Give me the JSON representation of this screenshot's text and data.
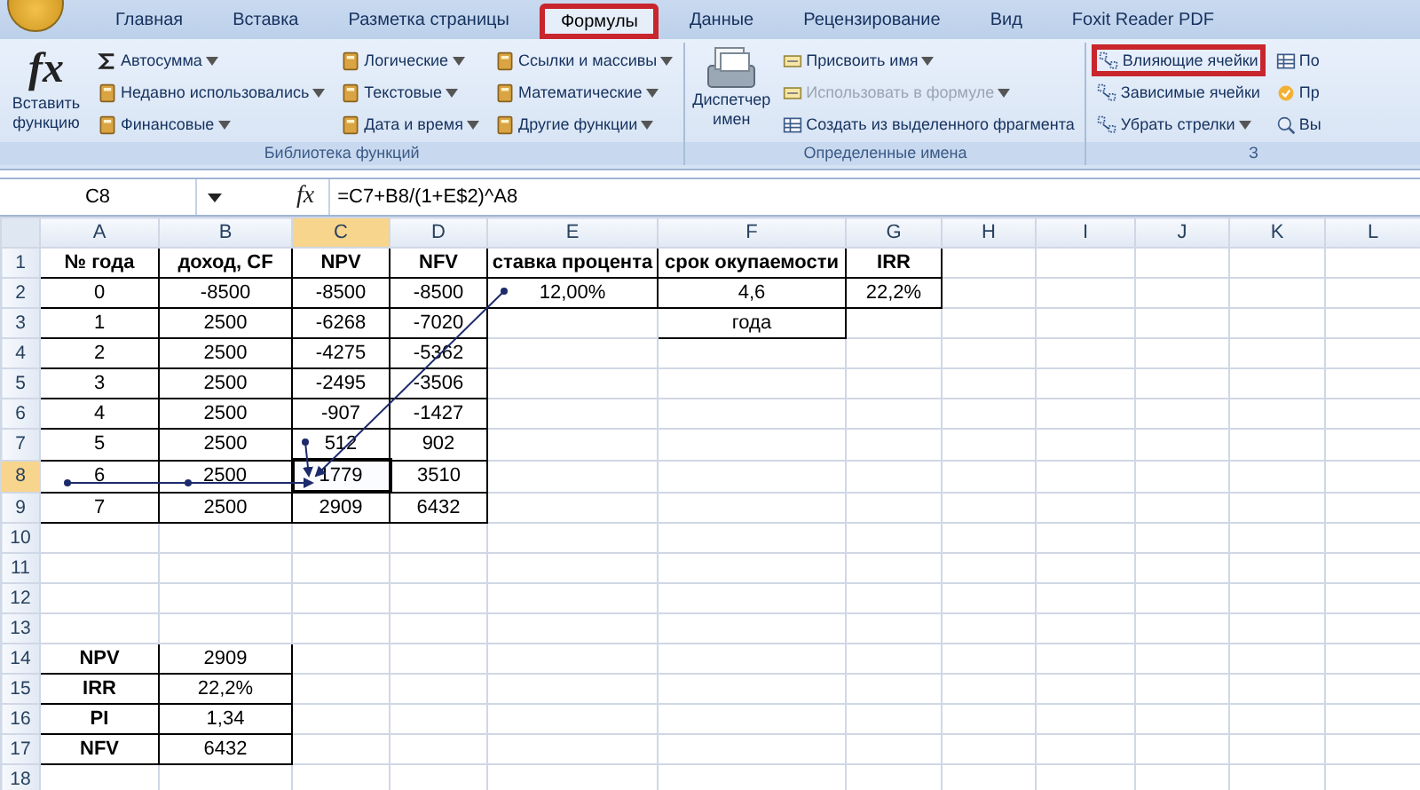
{
  "tabs": [
    {
      "label": "Главная",
      "selected": false,
      "highlighted": false
    },
    {
      "label": "Вставка",
      "selected": false,
      "highlighted": false
    },
    {
      "label": "Разметка страницы",
      "selected": false,
      "highlighted": false
    },
    {
      "label": "Формулы",
      "selected": true,
      "highlighted": true
    },
    {
      "label": "Данные",
      "selected": false,
      "highlighted": false
    },
    {
      "label": "Рецензирование",
      "selected": false,
      "highlighted": false
    },
    {
      "label": "Вид",
      "selected": false,
      "highlighted": false
    },
    {
      "label": "Foxit Reader PDF",
      "selected": false,
      "highlighted": false
    }
  ],
  "ribbon": {
    "groups": [
      {
        "label": "Библиотека функций",
        "columns": [
          [
            {
              "kind": "large",
              "icon_text": "fx",
              "label": "Вставить функцию",
              "disabled": false
            }
          ],
          [
            {
              "kind": "small",
              "label": "Автосумма",
              "dropdown": true,
              "disabled": false,
              "highlighted": false
            },
            {
              "kind": "small",
              "label": "Недавно использовались",
              "dropdown": true,
              "disabled": false,
              "highlighted": false
            },
            {
              "kind": "small",
              "label": "Финансовые",
              "dropdown": true,
              "disabled": false,
              "highlighted": false
            }
          ],
          [
            {
              "kind": "small",
              "label": "Логические",
              "dropdown": true,
              "disabled": false,
              "highlighted": false
            },
            {
              "kind": "small",
              "label": "Текстовые",
              "dropdown": true,
              "disabled": false,
              "highlighted": false
            },
            {
              "kind": "small",
              "label": "Дата и время",
              "dropdown": true,
              "disabled": false,
              "highlighted": false
            }
          ],
          [
            {
              "kind": "small",
              "label": "Ссылки и массивы",
              "dropdown": true,
              "disabled": false,
              "highlighted": false
            },
            {
              "kind": "small",
              "label": "Математические",
              "dropdown": true,
              "disabled": false,
              "highlighted": false
            },
            {
              "kind": "small",
              "label": "Другие функции",
              "dropdown": true,
              "disabled": false,
              "highlighted": false
            }
          ]
        ]
      },
      {
        "label": "Определенные имена",
        "columns": [
          [
            {
              "kind": "large",
              "label": "Диспетчер имен",
              "disabled": false
            }
          ],
          [
            {
              "kind": "small",
              "label": "Присвоить имя",
              "dropdown": true,
              "disabled": false,
              "highlighted": false
            },
            {
              "kind": "small",
              "label": "Использовать в формуле",
              "dropdown": true,
              "disabled": true,
              "highlighted": false
            },
            {
              "kind": "small",
              "label": "Создать из выделенного фрагмента",
              "dropdown": false,
              "disabled": false,
              "highlighted": false
            }
          ]
        ]
      },
      {
        "label": "З",
        "columns": [
          [
            {
              "kind": "small",
              "label": "Влияющие ячейки",
              "dropdown": false,
              "disabled": false,
              "highlighted": true
            },
            {
              "kind": "small",
              "label": "Зависимые ячейки",
              "dropdown": false,
              "disabled": false,
              "highlighted": false
            },
            {
              "kind": "small",
              "label": "Убрать стрелки",
              "dropdown": true,
              "disabled": false,
              "highlighted": false
            }
          ],
          [
            {
              "kind": "small",
              "label": "По",
              "dropdown": false,
              "disabled": false,
              "highlighted": false
            },
            {
              "kind": "small",
              "label": "Пр",
              "dropdown": false,
              "disabled": false,
              "highlighted": false
            },
            {
              "kind": "small",
              "label": "Вы",
              "dropdown": false,
              "disabled": false,
              "highlighted": false
            }
          ]
        ]
      }
    ]
  },
  "formula_bar": {
    "name_box": "C8",
    "fx_label": "fx",
    "formula": "=C7+B8/(1+E$2)^A8"
  },
  "sheet": {
    "columns": [
      {
        "letter": "A",
        "selected": false
      },
      {
        "letter": "B",
        "selected": false
      },
      {
        "letter": "C",
        "selected": true
      },
      {
        "letter": "D",
        "selected": false
      },
      {
        "letter": "E",
        "selected": false
      },
      {
        "letter": "F",
        "selected": false
      },
      {
        "letter": "G",
        "selected": false
      },
      {
        "letter": "H",
        "selected": false
      },
      {
        "letter": "I",
        "selected": false
      },
      {
        "letter": "J",
        "selected": false
      },
      {
        "letter": "K",
        "selected": false
      },
      {
        "letter": "L",
        "selected": false
      }
    ],
    "rows": [
      {
        "number": "1",
        "selected": false,
        "cells": {
          "A": {
            "text": "№ года",
            "bold": true,
            "bordered": true,
            "selected": false
          },
          "B": {
            "text": "доход, CF",
            "bold": true,
            "bordered": true,
            "selected": false
          },
          "C": {
            "text": "NPV",
            "bold": true,
            "bordered": true,
            "selected": false
          },
          "D": {
            "text": "NFV",
            "bold": true,
            "bordered": true,
            "selected": false
          },
          "E": {
            "text": "ставка процента",
            "bold": true,
            "bordered": true,
            "selected": false
          },
          "F": {
            "text": "срок окупаемости",
            "bold": true,
            "bordered": true,
            "selected": false
          },
          "G": {
            "text": "IRR",
            "bold": true,
            "bordered": true,
            "selected": false
          }
        }
      },
      {
        "number": "2",
        "selected": false,
        "cells": {
          "A": {
            "text": "0",
            "bold": false,
            "bordered": true,
            "selected": false
          },
          "B": {
            "text": "-8500",
            "bold": false,
            "bordered": true,
            "selected": false
          },
          "C": {
            "text": "-8500",
            "bold": false,
            "bordered": true,
            "selected": false
          },
          "D": {
            "text": "-8500",
            "bold": false,
            "bordered": true,
            "selected": false
          },
          "E": {
            "text": "12,00%",
            "bold": false,
            "bordered": true,
            "selected": false
          },
          "F": {
            "text": "4,6",
            "bold": false,
            "bordered": true,
            "selected": false
          },
          "G": {
            "text": "22,2%",
            "bold": false,
            "bordered": true,
            "selected": false
          }
        }
      },
      {
        "number": "3",
        "selected": false,
        "cells": {
          "A": {
            "text": "1",
            "bold": false,
            "bordered": true,
            "selected": false
          },
          "B": {
            "text": "2500",
            "bold": false,
            "bordered": true,
            "selected": false
          },
          "C": {
            "text": "-6268",
            "bold": false,
            "bordered": true,
            "selected": false
          },
          "D": {
            "text": "-7020",
            "bold": false,
            "bordered": true,
            "selected": false
          },
          "F": {
            "text": "года",
            "bold": false,
            "bordered": true,
            "selected": false
          }
        }
      },
      {
        "number": "4",
        "selected": false,
        "cells": {
          "A": {
            "text": "2",
            "bold": false,
            "bordered": true,
            "selected": false
          },
          "B": {
            "text": "2500",
            "bold": false,
            "bordered": true,
            "selected": false
          },
          "C": {
            "text": "-4275",
            "bold": false,
            "bordered": true,
            "selected": false
          },
          "D": {
            "text": "-5362",
            "bold": false,
            "bordered": true,
            "selected": false
          }
        }
      },
      {
        "number": "5",
        "selected": false,
        "cells": {
          "A": {
            "text": "3",
            "bold": false,
            "bordered": true,
            "selected": false
          },
          "B": {
            "text": "2500",
            "bold": false,
            "bordered": true,
            "selected": false
          },
          "C": {
            "text": "-2495",
            "bold": false,
            "bordered": true,
            "selected": false
          },
          "D": {
            "text": "-3506",
            "bold": false,
            "bordered": true,
            "selected": false
          }
        }
      },
      {
        "number": "6",
        "selected": false,
        "cells": {
          "A": {
            "text": "4",
            "bold": false,
            "bordered": true,
            "selected": false
          },
          "B": {
            "text": "2500",
            "bold": false,
            "bordered": true,
            "selected": false
          },
          "C": {
            "text": "-907",
            "bold": false,
            "bordered": true,
            "selected": false
          },
          "D": {
            "text": "-1427",
            "bold": false,
            "bordered": true,
            "selected": false
          }
        }
      },
      {
        "number": "7",
        "selected": false,
        "cells": {
          "A": {
            "text": "5",
            "bold": false,
            "bordered": true,
            "selected": false
          },
          "B": {
            "text": "2500",
            "bold": false,
            "bordered": true,
            "selected": false
          },
          "C": {
            "text": "512",
            "bold": false,
            "bordered": true,
            "selected": false
          },
          "D": {
            "text": "902",
            "bold": false,
            "bordered": true,
            "selected": false
          }
        }
      },
      {
        "number": "8",
        "selected": true,
        "cells": {
          "A": {
            "text": "6",
            "bold": false,
            "bordered": true,
            "selected": false
          },
          "B": {
            "text": "2500",
            "bold": false,
            "bordered": true,
            "selected": false
          },
          "C": {
            "text": "1779",
            "bold": false,
            "bordered": true,
            "selected": true
          },
          "D": {
            "text": "3510",
            "bold": false,
            "bordered": true,
            "selected": false
          }
        }
      },
      {
        "number": "9",
        "selected": false,
        "cells": {
          "A": {
            "text": "7",
            "bold": false,
            "bordered": true,
            "selected": false
          },
          "B": {
            "text": "2500",
            "bold": false,
            "bordered": true,
            "selected": false
          },
          "C": {
            "text": "2909",
            "bold": false,
            "bordered": true,
            "selected": false
          },
          "D": {
            "text": "6432",
            "bold": false,
            "bordered": true,
            "selected": false
          }
        }
      },
      {
        "number": "10",
        "selected": false
      },
      {
        "number": "11",
        "selected": false
      },
      {
        "number": "12",
        "selected": false
      },
      {
        "number": "13",
        "selected": false
      },
      {
        "number": "14",
        "selected": false,
        "cells": {
          "A": {
            "text": "NPV",
            "bold": true,
            "bordered": true,
            "selected": false
          },
          "B": {
            "text": "2909",
            "bold": false,
            "bordered": true,
            "selected": false
          }
        }
      },
      {
        "number": "15",
        "selected": false,
        "cells": {
          "A": {
            "text": "IRR",
            "bold": true,
            "bordered": true,
            "selected": false
          },
          "B": {
            "text": "22,2%",
            "bold": false,
            "bordered": true,
            "selected": false
          }
        }
      },
      {
        "number": "16",
        "selected": false,
        "cells": {
          "A": {
            "text": "PI",
            "bold": true,
            "bordered": true,
            "selected": false
          },
          "B": {
            "text": "1,34",
            "bold": false,
            "bordered": true,
            "selected": false
          }
        }
      },
      {
        "number": "17",
        "selected": false,
        "cells": {
          "A": {
            "text": "NFV",
            "bold": true,
            "bordered": true,
            "selected": false
          },
          "B": {
            "text": "6432",
            "bold": false,
            "bordered": true,
            "selected": false
          }
        }
      },
      {
        "number": "18",
        "selected": false
      }
    ]
  }
}
